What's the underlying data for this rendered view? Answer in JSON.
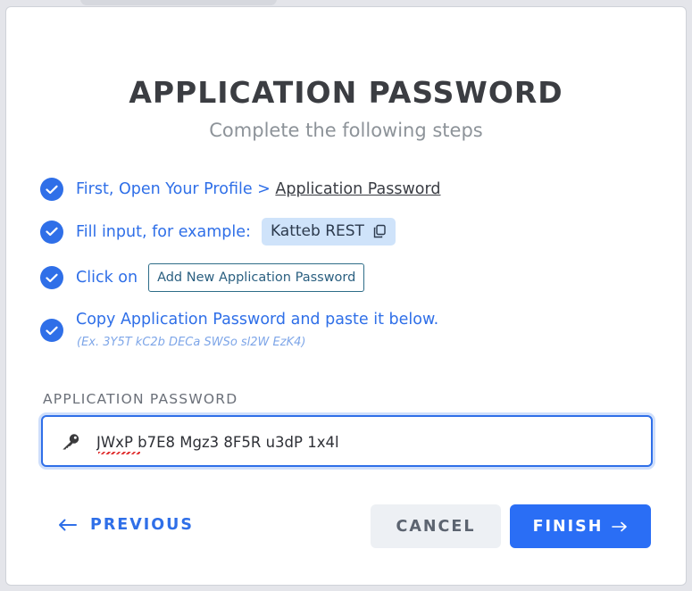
{
  "modal": {
    "title": "APPLICATION PASSWORD",
    "subtitle": "Complete the following steps"
  },
  "steps": [
    {
      "prefix": "First, Open Your Profile > ",
      "link": "Application Password"
    },
    {
      "text": "Fill input, for example:",
      "example": "Katteb REST",
      "example_icon": "copy-icon"
    },
    {
      "text": "Click on",
      "button": "Add New Application Password"
    },
    {
      "text": "Copy Application Password and paste it below.",
      "hint": "(Ex. 3Y5T kC2b DECa SWSo sl2W EzK4)"
    }
  ],
  "field": {
    "label": "APPLICATION PASSWORD",
    "value": "JWxP b7E8 Mgz3 8F5R u3dP 1x4l",
    "icon": "key-icon"
  },
  "actions": {
    "previous": "PREVIOUS",
    "cancel": "CANCEL",
    "finish": "FINISH"
  },
  "colors": {
    "accent": "#2f6fe8",
    "chip_bg": "#cfe3fa",
    "cancel_bg": "#edf0f4"
  }
}
